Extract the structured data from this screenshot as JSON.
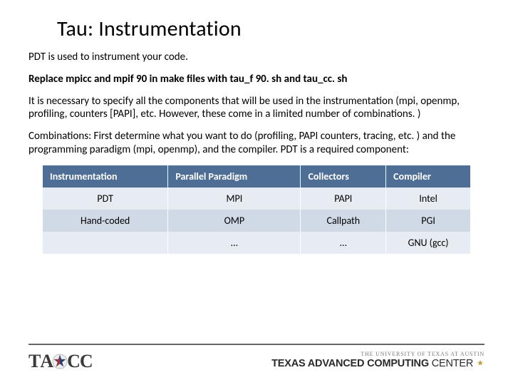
{
  "title": "Tau: Instrumentation",
  "body": {
    "p1": "PDT is used to instrument your code.",
    "p2": "Replace mpicc and mpif 90 in make files with tau_f 90. sh and tau_cc. sh",
    "p3": "It is necessary to specify all the components that will be used in the instrumentation (mpi, openmp, profiling, counters [PAPI], etc. However, these come in a limited number of combinations. )",
    "p4": "Combinations: First determine what  you want to do (profiling, PAPI counters, tracing, etc. ) and the programming paradigm (mpi, openmp), and the compiler.  PDT is a required component:"
  },
  "table": {
    "headers": [
      "Instrumentation",
      "Parallel Paradigm",
      "Collectors",
      "Compiler"
    ],
    "rows": [
      [
        "PDT",
        "MPI",
        "PAPI",
        "Intel"
      ],
      [
        "Hand-coded",
        "OMP",
        "Callpath",
        "PGI"
      ],
      [
        "",
        "…",
        "…",
        "GNU (gcc)"
      ]
    ]
  },
  "footer": {
    "ut": "THE UNIVERSITY OF TEXAS AT AUSTIN",
    "tacc_big_a": "TEXAS ADVANCED COMPUTING ",
    "tacc_big_b": "CENTER",
    "tacc_logo_letters": [
      "T",
      "A",
      "C",
      "C"
    ]
  }
}
